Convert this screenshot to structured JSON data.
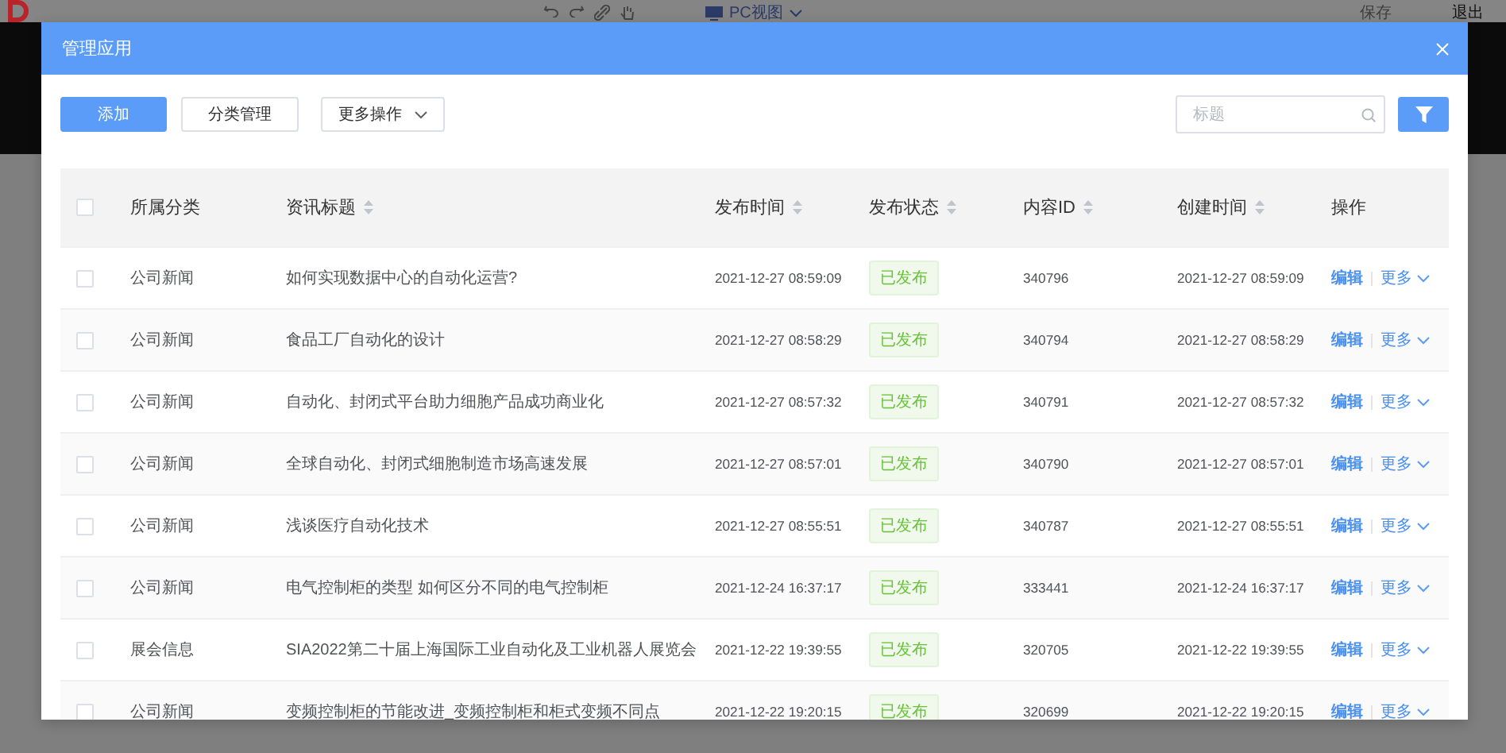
{
  "page": {
    "view_label": "PC视图",
    "save": "保存",
    "exit": "退出"
  },
  "dialog": {
    "title": "管理应用"
  },
  "actions": [
    {
      "label": "添加",
      "kind": "primary"
    },
    {
      "label": "分类管理",
      "kind": "default"
    },
    {
      "label": "更多操作",
      "kind": "dropdown"
    }
  ],
  "search": {
    "placeholder": "标题"
  },
  "table": {
    "select_all": {
      "checked": false
    },
    "columns": [
      {
        "label": "所属分类",
        "sortable": false
      },
      {
        "label": "资讯标题",
        "sortable": true
      },
      {
        "label": "发布时间",
        "sortable": true
      },
      {
        "label": "发布状态",
        "sortable": true
      },
      {
        "label": "内容ID",
        "sortable": true
      },
      {
        "label": "创建时间",
        "sortable": true
      },
      {
        "label": "操作",
        "sortable": false
      }
    ],
    "rows": [
      {
        "selected": false,
        "category": "公司新闻",
        "title": "如何实现数据中心的自动化运营?",
        "published_at": "2021-12-27 08:59:09",
        "status": "已发布",
        "content_id": "340796",
        "created_at": "2021-12-27 08:59:09",
        "edit": "编辑",
        "more": "更多"
      },
      {
        "selected": false,
        "category": "公司新闻",
        "title": "食品工厂自动化的设计",
        "published_at": "2021-12-27 08:58:29",
        "status": "已发布",
        "content_id": "340794",
        "created_at": "2021-12-27 08:58:29",
        "edit": "编辑",
        "more": "更多"
      },
      {
        "selected": false,
        "category": "公司新闻",
        "title": "自动化、封闭式平台助力细胞产品成功商业化",
        "published_at": "2021-12-27 08:57:32",
        "status": "已发布",
        "content_id": "340791",
        "created_at": "2021-12-27 08:57:32",
        "edit": "编辑",
        "more": "更多"
      },
      {
        "selected": false,
        "category": "公司新闻",
        "title": "全球自动化、封闭式细胞制造市场高速发展",
        "published_at": "2021-12-27 08:57:01",
        "status": "已发布",
        "content_id": "340790",
        "created_at": "2021-12-27 08:57:01",
        "edit": "编辑",
        "more": "更多"
      },
      {
        "selected": false,
        "category": "公司新闻",
        "title": "浅谈医疗自动化技术",
        "published_at": "2021-12-27 08:55:51",
        "status": "已发布",
        "content_id": "340787",
        "created_at": "2021-12-27 08:55:51",
        "edit": "编辑",
        "more": "更多"
      },
      {
        "selected": false,
        "category": "公司新闻",
        "title": "电气控制柜的类型 如何区分不同的电气控制柜",
        "published_at": "2021-12-24 16:37:17",
        "status": "已发布",
        "content_id": "333441",
        "created_at": "2021-12-24 16:37:17",
        "edit": "编辑",
        "more": "更多"
      },
      {
        "selected": false,
        "category": "展会信息",
        "title": "SIA2022第二十届上海国际工业自动化及工业机器人展览会",
        "published_at": "2021-12-22 19:39:55",
        "status": "已发布",
        "content_id": "320705",
        "created_at": "2021-12-22 19:39:55",
        "edit": "编辑",
        "more": "更多"
      },
      {
        "selected": false,
        "category": "公司新闻",
        "title": "变频控制柜的节能改进_变频控制柜和柜式变频不同点",
        "published_at": "2021-12-22 19:20:15",
        "status": "已发布",
        "content_id": "320699",
        "created_at": "2021-12-22 19:20:15",
        "edit": "编辑",
        "more": "更多"
      }
    ]
  }
}
